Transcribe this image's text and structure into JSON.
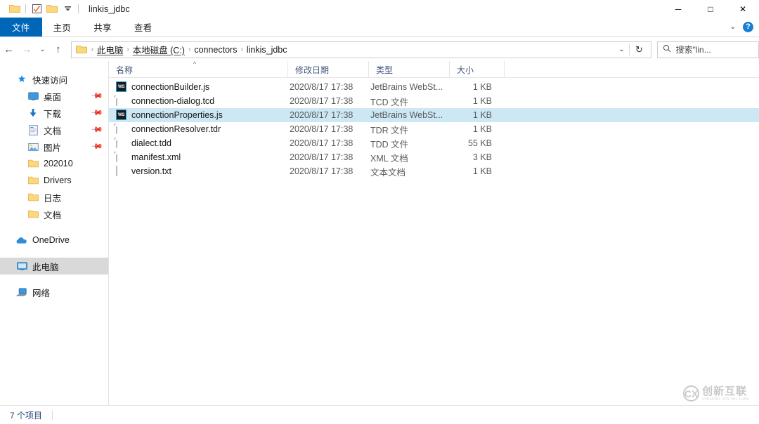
{
  "window": {
    "title": "linkis_jdbc",
    "quick_access": [
      {
        "name": "folder-icon",
        "label": ""
      },
      {
        "name": "properties-icon",
        "label": ""
      },
      {
        "name": "new-folder-icon",
        "label": ""
      },
      {
        "name": "chevron-down-icon",
        "label": "▾"
      }
    ],
    "controls": {
      "minimize": "─",
      "maximize": "□",
      "close": "✕"
    }
  },
  "ribbon": {
    "tabs": [
      {
        "label": "文件",
        "active": true
      },
      {
        "label": "主页",
        "active": false
      },
      {
        "label": "共享",
        "active": false
      },
      {
        "label": "查看",
        "active": false
      }
    ],
    "collapse_icon": "⌄",
    "help_icon": "?"
  },
  "address": {
    "back_icon": "←",
    "forward_icon": "→",
    "history_icon": "⌄",
    "up_icon": "↑",
    "breadcrumbs": [
      "此电脑",
      "本地磁盘 (C:)",
      "connectors",
      "linkis_jdbc"
    ],
    "separator": "›",
    "dropdown_icon": "⌄",
    "refresh_icon": "↻"
  },
  "search": {
    "icon": "search-icon",
    "placeholder": "搜索\"lin..."
  },
  "sidebar": {
    "quick_access": {
      "label": "快速访问",
      "icon": "star-icon"
    },
    "pinned": [
      {
        "label": "桌面",
        "icon": "desktop-icon",
        "pinned": true
      },
      {
        "label": "下载",
        "icon": "download-icon",
        "pinned": true
      },
      {
        "label": "文档",
        "icon": "documents-icon",
        "pinned": true
      },
      {
        "label": "图片",
        "icon": "pictures-icon",
        "pinned": true
      },
      {
        "label": "202010",
        "icon": "folder-icon",
        "pinned": false
      },
      {
        "label": "Drivers",
        "icon": "folder-icon",
        "pinned": false
      },
      {
        "label": "日志",
        "icon": "folder-icon",
        "pinned": false
      },
      {
        "label": "文档",
        "icon": "folder-icon",
        "pinned": false
      }
    ],
    "onedrive": {
      "label": "OneDrive",
      "icon": "cloud-icon"
    },
    "this_pc": {
      "label": "此电脑",
      "icon": "computer-icon",
      "selected": true
    },
    "network": {
      "label": "网络",
      "icon": "network-icon"
    }
  },
  "filelist": {
    "columns": {
      "name": "名称",
      "date": "修改日期",
      "type": "类型",
      "size": "大小",
      "sort_caret": "^"
    },
    "rows": [
      {
        "name": "connectionBuilder.js",
        "date": "2020/8/17 17:38",
        "type": "JetBrains WebSt...",
        "size": "1 KB",
        "icon": "webstorm-js-icon",
        "selected": false
      },
      {
        "name": "connection-dialog.tcd",
        "date": "2020/8/17 17:38",
        "type": "TCD 文件",
        "size": "1 KB",
        "icon": "generic-file-icon",
        "selected": false
      },
      {
        "name": "connectionProperties.js",
        "date": "2020/8/17 17:38",
        "type": "JetBrains WebSt...",
        "size": "1 KB",
        "icon": "webstorm-js-icon",
        "selected": true
      },
      {
        "name": "connectionResolver.tdr",
        "date": "2020/8/17 17:38",
        "type": "TDR 文件",
        "size": "1 KB",
        "icon": "generic-file-icon",
        "selected": false
      },
      {
        "name": "dialect.tdd",
        "date": "2020/8/17 17:38",
        "type": "TDD 文件",
        "size": "55 KB",
        "icon": "generic-file-icon",
        "selected": false
      },
      {
        "name": "manifest.xml",
        "date": "2020/8/17 17:38",
        "type": "XML 文档",
        "size": "3 KB",
        "icon": "generic-file-icon",
        "selected": false
      },
      {
        "name": "version.txt",
        "date": "2020/8/17 17:38",
        "type": "文本文档",
        "size": "1 KB",
        "icon": "text-file-icon",
        "selected": false
      }
    ]
  },
  "status": {
    "item_count": "7 个项目"
  },
  "watermark": {
    "mark": "CX",
    "name_cn": "创新互联",
    "name_py": "CHUANG XIN HU LIAN"
  },
  "colors": {
    "accent_blue": "#0066b8",
    "selection_blue": "#cce8f4",
    "sidebar_selection": "#d9d9d9",
    "header_text": "#43557a",
    "folder_yellow": "#fcd77f"
  }
}
